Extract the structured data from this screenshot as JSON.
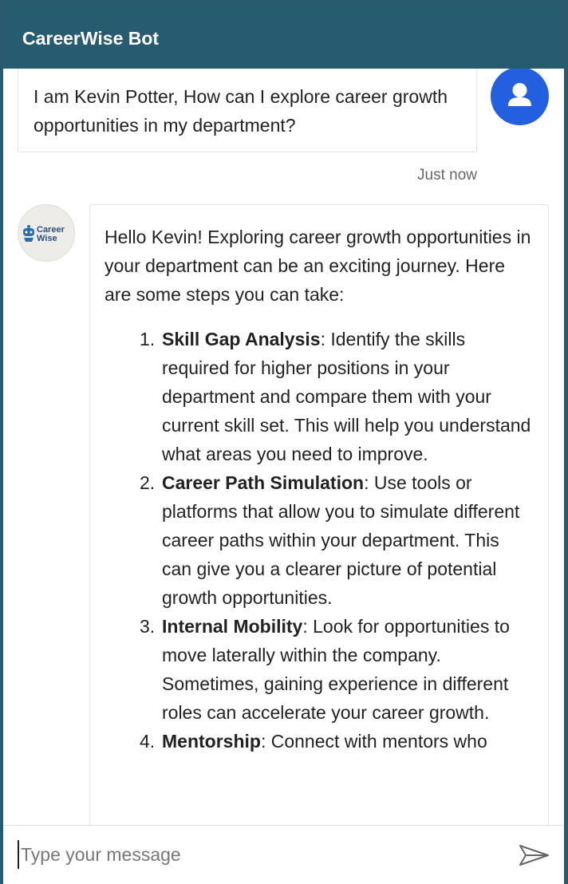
{
  "header": {
    "title": "CareerWise Bot"
  },
  "user_message": {
    "text": "I am Kevin Potter, How can I explore career growth opportunities in my department?",
    "timestamp": "Just now",
    "avatar_icon": "user-avatar-icon"
  },
  "bot": {
    "logo_line1": "Career",
    "logo_line2": "Wise",
    "intro": "Hello Kevin! Exploring career growth opportunities in your department can be an exciting journey. Here are some steps you can take:",
    "steps": [
      {
        "num": "1.",
        "title": "Skill Gap Analysis",
        "text": ": Identify the skills required for higher positions in your department and compare them with your current skill set. This will help you understand what areas you need to improve."
      },
      {
        "num": "2.",
        "title": "Career Path Simulation",
        "text": ": Use tools or platforms that allow you to simulate different career paths within your department. This can give you a clearer picture of potential growth opportunities."
      },
      {
        "num": "3.",
        "title": "Internal Mobility",
        "text": ": Look for opportunities to move laterally within the company. Sometimes, gaining experience in different roles can accelerate your career growth."
      },
      {
        "num": "4.",
        "title": "Mentorship",
        "text": ": Connect with mentors who"
      }
    ]
  },
  "input": {
    "placeholder": "Type your message",
    "send_icon": "send-icon"
  },
  "colors": {
    "header": "#275b6f",
    "frame": "#2a5a6e",
    "user_avatar": "#2360e0"
  }
}
